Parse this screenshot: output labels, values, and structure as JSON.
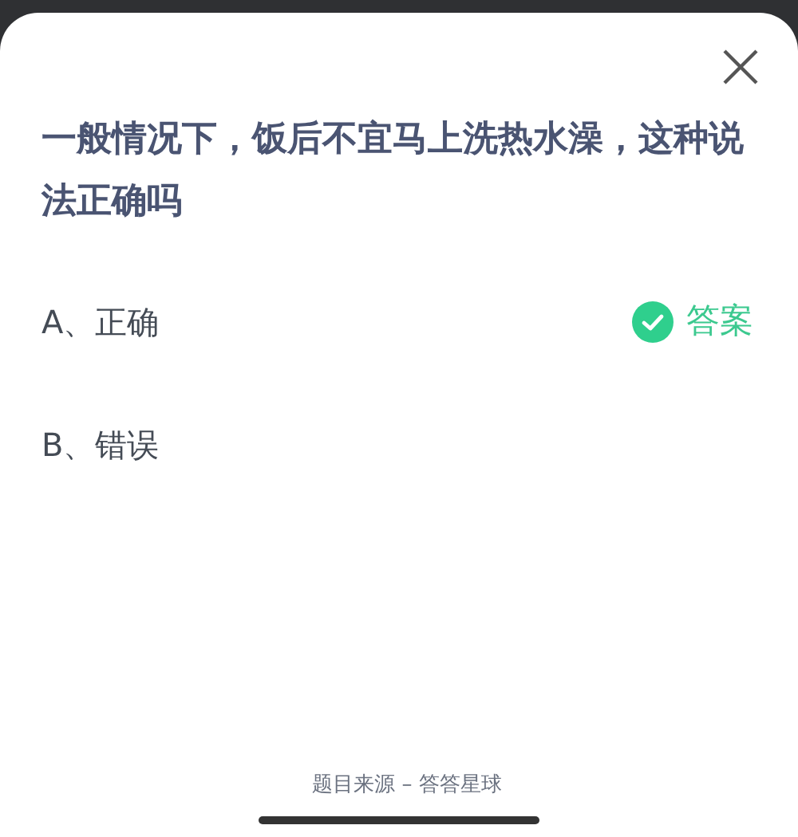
{
  "question": "一般情况下，饭后不宜马上洗热水澡，这种说法正确吗",
  "options": [
    {
      "label": "A、正确",
      "correct": true
    },
    {
      "label": "B、错误",
      "correct": false
    }
  ],
  "answer_label": "答案",
  "source": "题目来源 – 答答星球"
}
